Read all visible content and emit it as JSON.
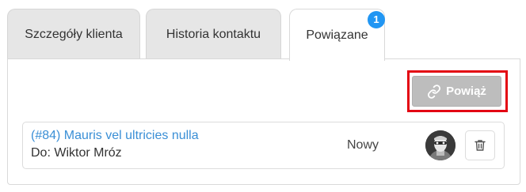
{
  "tabs": [
    {
      "label": "Szczegóły klienta"
    },
    {
      "label": "Historia kontaktu"
    },
    {
      "label": "Powiązane",
      "badge": "1"
    }
  ],
  "toolbar": {
    "link_label": "Powiąż",
    "link_icon": "link-icon"
  },
  "related_items": [
    {
      "title": "(#84) Mauris vel ultricies nulla",
      "subtitle": "Do: Wiktor Mróz",
      "status": "Nowy",
      "delete_icon": "trash-icon"
    }
  ],
  "colors": {
    "accent": "#2196f3",
    "link_text": "#3a8fd6",
    "disabled_button": "#bdbdbd",
    "highlight": "#e30613"
  }
}
